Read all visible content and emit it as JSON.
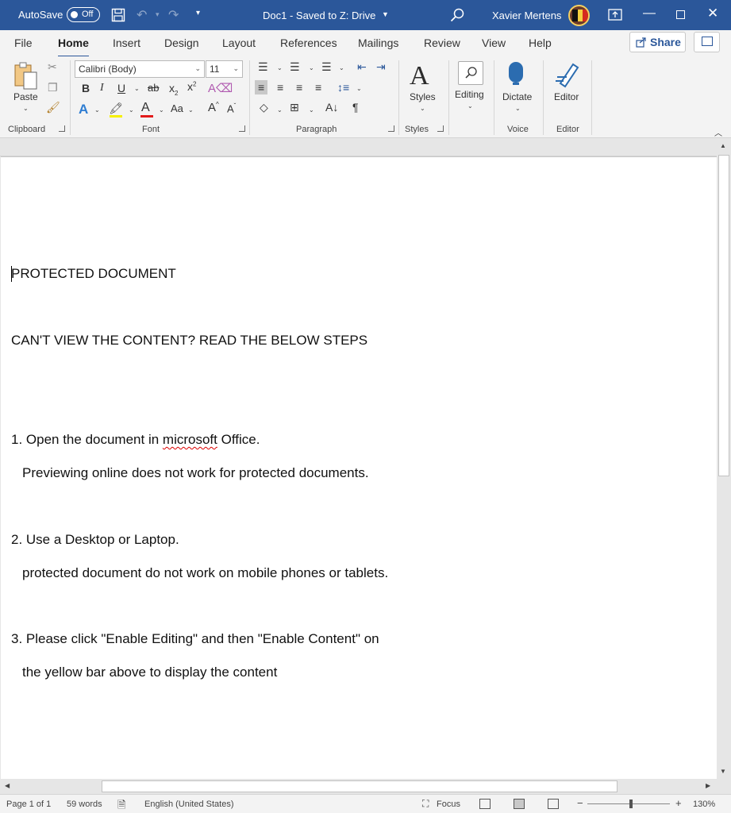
{
  "title_bar": {
    "autosave_label": "AutoSave",
    "autosave_state": "Off",
    "document_title": "Doc1  -  Saved to Z: Drive",
    "user_name": "Xavier Mertens",
    "accent_color": "#2b579a"
  },
  "tabs": [
    {
      "label": "File"
    },
    {
      "label": "Home",
      "active": true
    },
    {
      "label": "Insert"
    },
    {
      "label": "Design"
    },
    {
      "label": "Layout"
    },
    {
      "label": "References"
    },
    {
      "label": "Mailings"
    },
    {
      "label": "Review"
    },
    {
      "label": "View"
    },
    {
      "label": "Help"
    }
  ],
  "share_label": "Share",
  "ribbon": {
    "clipboard": {
      "group_label": "Clipboard",
      "paste_label": "Paste"
    },
    "font": {
      "group_label": "Font",
      "font_name": "Calibri (Body)",
      "font_size": "11",
      "bold": "B",
      "italic": "I",
      "underline": "U",
      "strike": "ab",
      "subscript": "x",
      "superscript": "x",
      "change_case": "Aa"
    },
    "paragraph": {
      "group_label": "Paragraph",
      "show_marks": "¶"
    },
    "styles": {
      "group_label": "Styles",
      "styles_label": "Styles"
    },
    "editing": {
      "editing_label": "Editing"
    },
    "voice": {
      "group_label": "Voice",
      "dictate_label": "Dictate"
    },
    "editor": {
      "group_label": "Editor",
      "editor_label": "Editor"
    }
  },
  "document": {
    "lines": [
      "PROTECTED DOCUMENT",
      "CAN'T VIEW THE CONTENT? READ THE BELOW STEPS",
      "1. Open the document in ",
      "microsoft",
      " Office.",
      "Previewing online does not work for protected documents.",
      "2. Use a Desktop or Laptop.",
      "protected document do not work on mobile phones or tablets.",
      "3. Please click \"Enable Editing\" and then \"Enable Content\" on",
      "the yellow bar above to display the content"
    ]
  },
  "status_bar": {
    "page": "Page 1 of 1",
    "words": "59 words",
    "language": "English (United States)",
    "focus": "Focus",
    "zoom": "130%"
  }
}
